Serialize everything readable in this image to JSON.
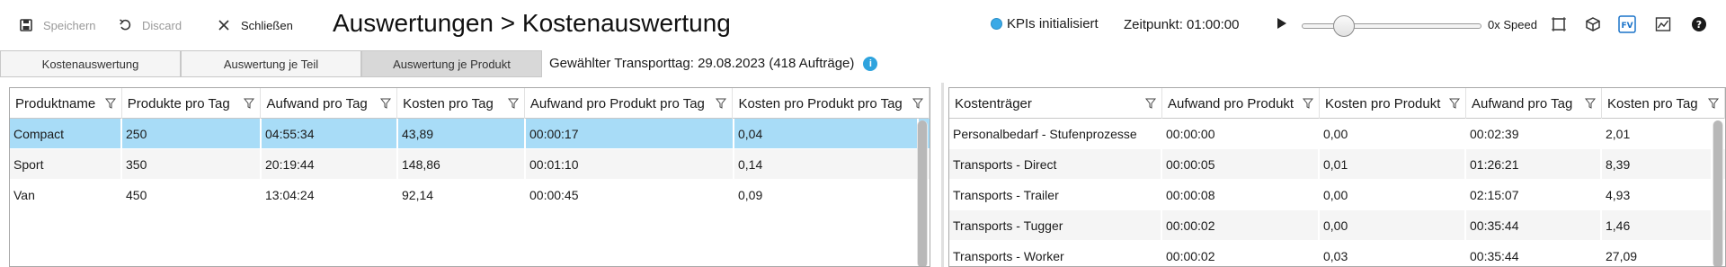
{
  "toolbar": {
    "save_label": "Speichern",
    "discard_label": "Discard",
    "close_label": "Schließen",
    "title": "Auswertungen > Kostenauswertung",
    "kpi_label": "KPIs initialisiert",
    "time_label": "Zeitpunkt: 01:00:00",
    "speed_label": "0x Speed",
    "fv_label": "FV",
    "kpi_color": "#3aa9e6"
  },
  "tabs": [
    {
      "label": "Kostenauswertung",
      "active": false
    },
    {
      "label": "Auswertung je Teil",
      "active": false
    },
    {
      "label": "Auswertung je Produkt",
      "active": true
    }
  ],
  "transport_day": "Gewählter Transporttag: 29.08.2023 (418 Aufträge)",
  "left_table": {
    "columns": [
      "Produktname",
      "Produkte pro Tag",
      "Aufwand pro Tag",
      "Kosten pro Tag",
      "Aufwand pro Produkt pro Tag",
      "Kosten pro Produkt pro Tag"
    ],
    "rows": [
      [
        "Compact",
        "250",
        "04:55:34",
        "43,89",
        "00:00:17",
        "0,04"
      ],
      [
        "Sport",
        "350",
        "20:19:44",
        "148,86",
        "00:01:10",
        "0,14"
      ],
      [
        "Van",
        "450",
        "13:04:24",
        "92,14",
        "00:00:45",
        "0,09"
      ]
    ],
    "selected_row": 0
  },
  "right_table": {
    "columns": [
      "Kostenträger",
      "Aufwand pro Produkt",
      "Kosten pro Produkt",
      "Aufwand pro Tag",
      "Kosten pro Tag"
    ],
    "rows": [
      [
        "Personalbedarf - Stufenprozesse",
        "00:00:00",
        "0,00",
        "00:02:39",
        "2,01"
      ],
      [
        "Transports - Direct",
        "00:00:05",
        "0,01",
        "01:26:21",
        "8,39"
      ],
      [
        "Transports - Trailer",
        "00:00:08",
        "0,00",
        "02:15:07",
        "4,93"
      ],
      [
        "Transports - Tugger",
        "00:00:02",
        "0,00",
        "00:35:44",
        "1,46"
      ],
      [
        "Transports - Worker",
        "00:00:02",
        "0,03",
        "00:35:44",
        "27,09"
      ]
    ]
  }
}
